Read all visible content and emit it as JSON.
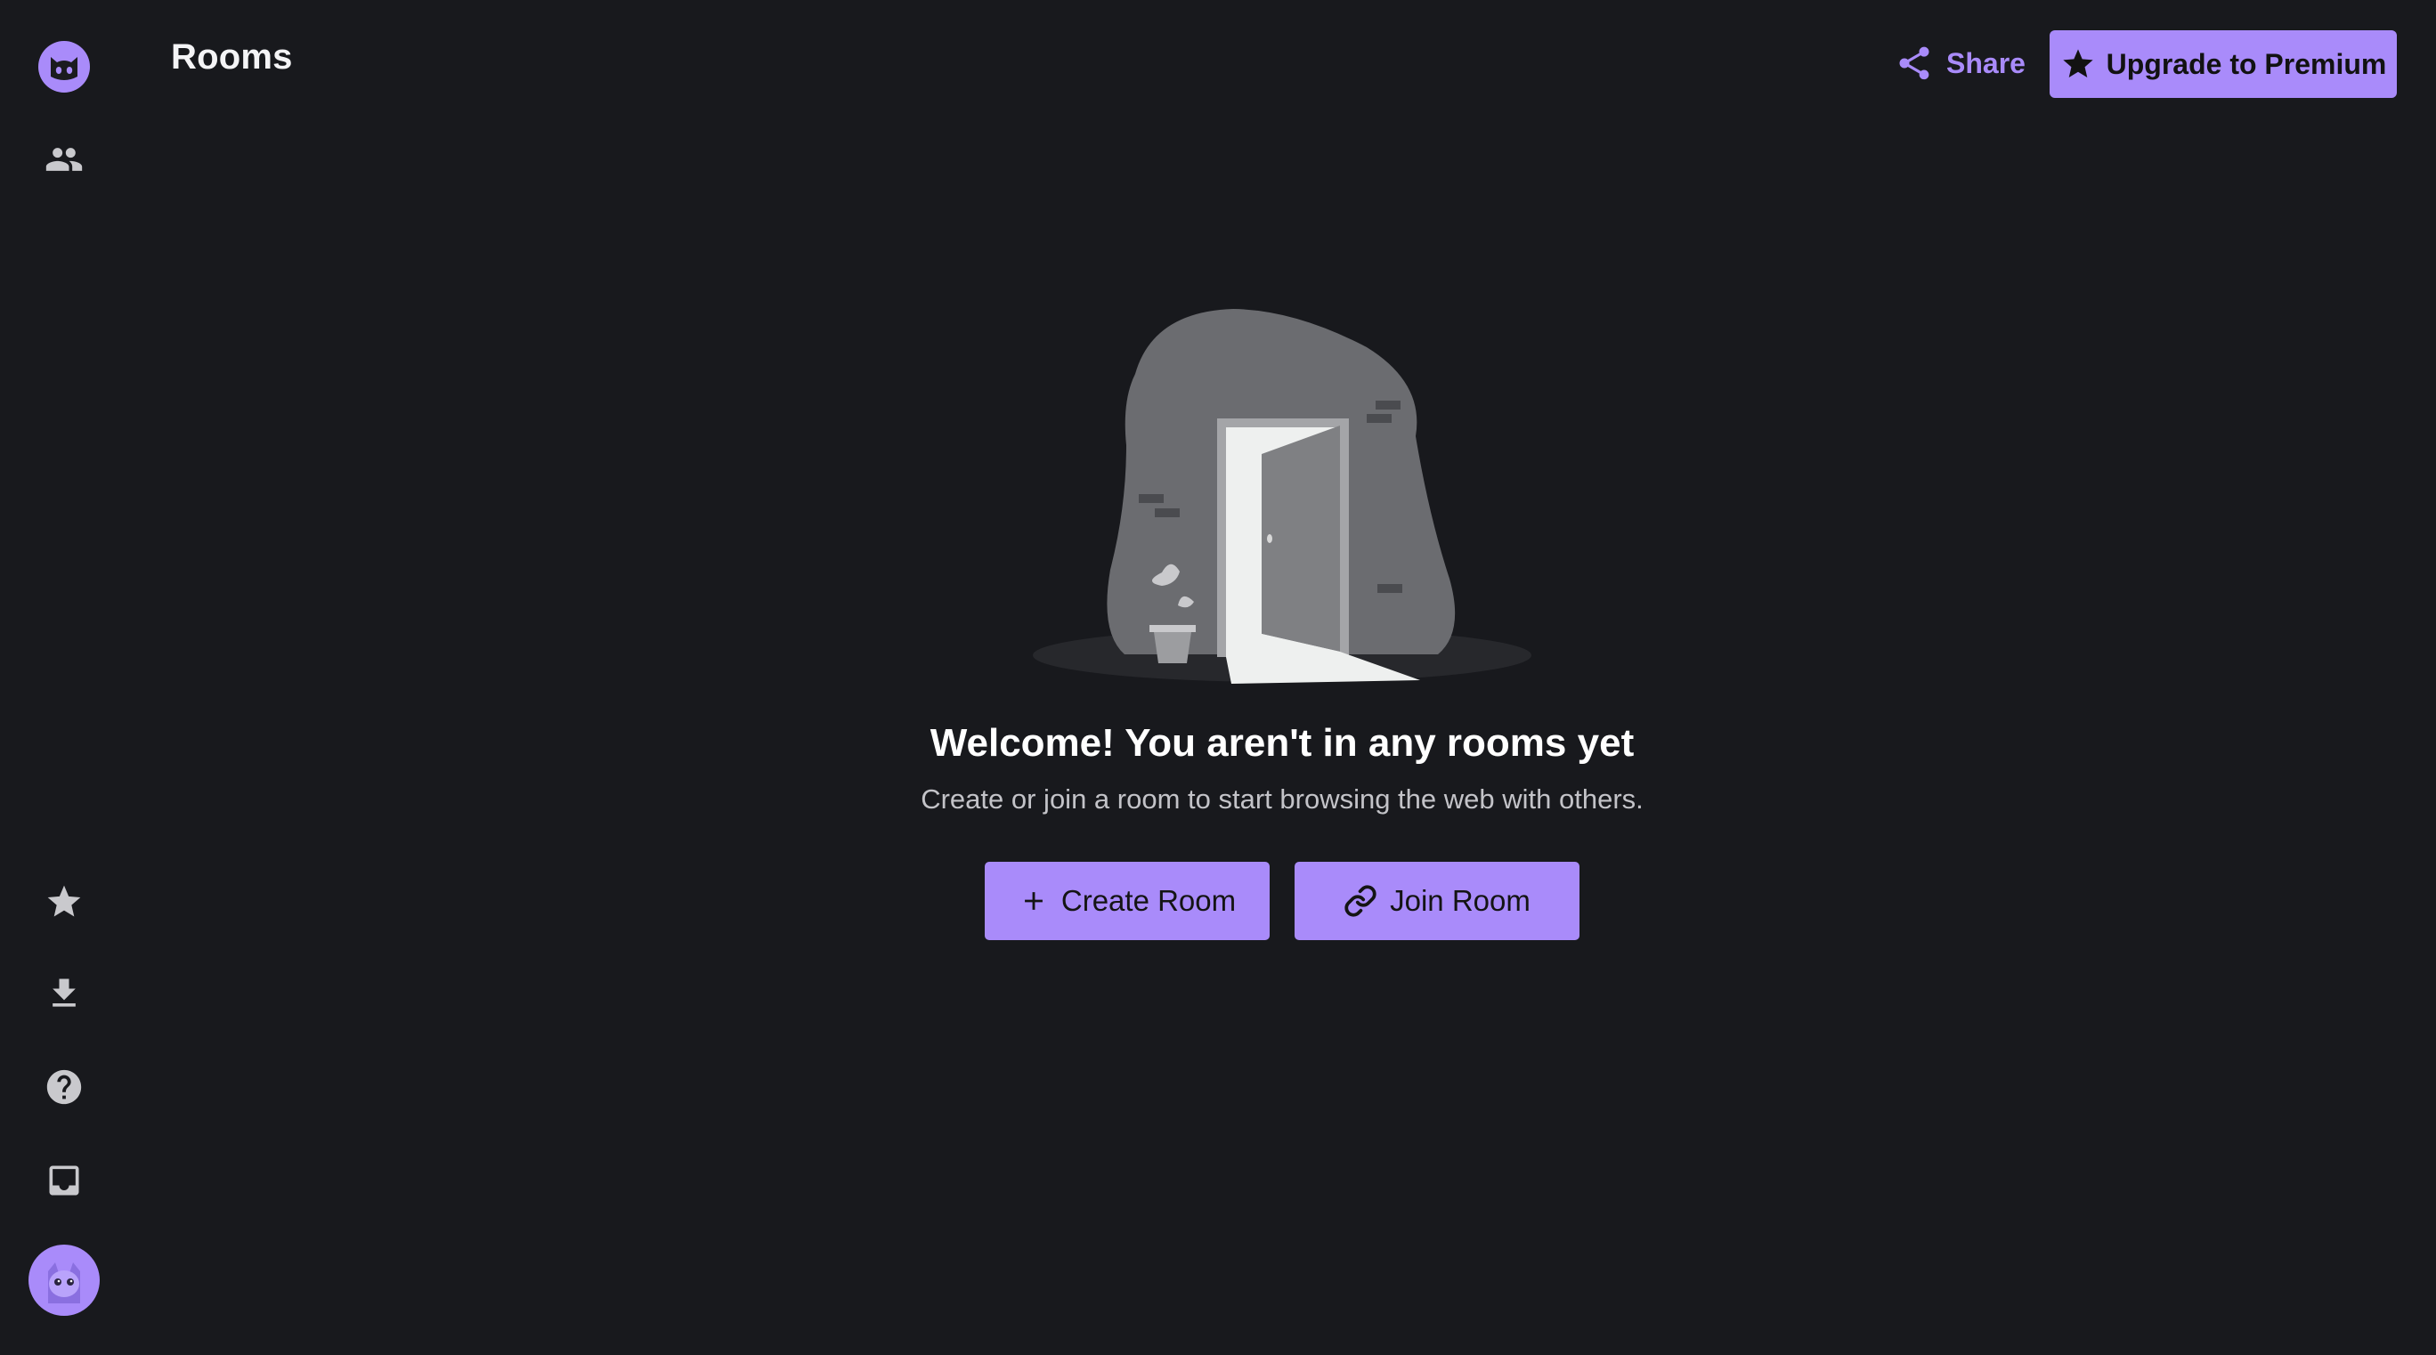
{
  "header": {
    "title": "Rooms",
    "share_label": "Share",
    "upgrade_label": "Upgrade to Premium"
  },
  "sidebar": {
    "top_items": [
      {
        "name": "logo",
        "icon": "cat-logo-icon"
      },
      {
        "name": "friends",
        "icon": "people-icon"
      }
    ],
    "bottom_items": [
      {
        "name": "favorites",
        "icon": "star-icon"
      },
      {
        "name": "download",
        "icon": "download-icon"
      },
      {
        "name": "help",
        "icon": "help-icon"
      },
      {
        "name": "inbox",
        "icon": "inbox-icon"
      },
      {
        "name": "profile",
        "icon": "avatar"
      }
    ]
  },
  "empty_state": {
    "title": "Welcome! You aren't in any rooms yet",
    "subtitle": "Create or join a room to start browsing the web with others.",
    "create_label": "Create Room",
    "join_label": "Join Room"
  },
  "colors": {
    "background": "#18191d",
    "accent": "#a98bfa",
    "icon_gray": "#c9c9cd"
  }
}
